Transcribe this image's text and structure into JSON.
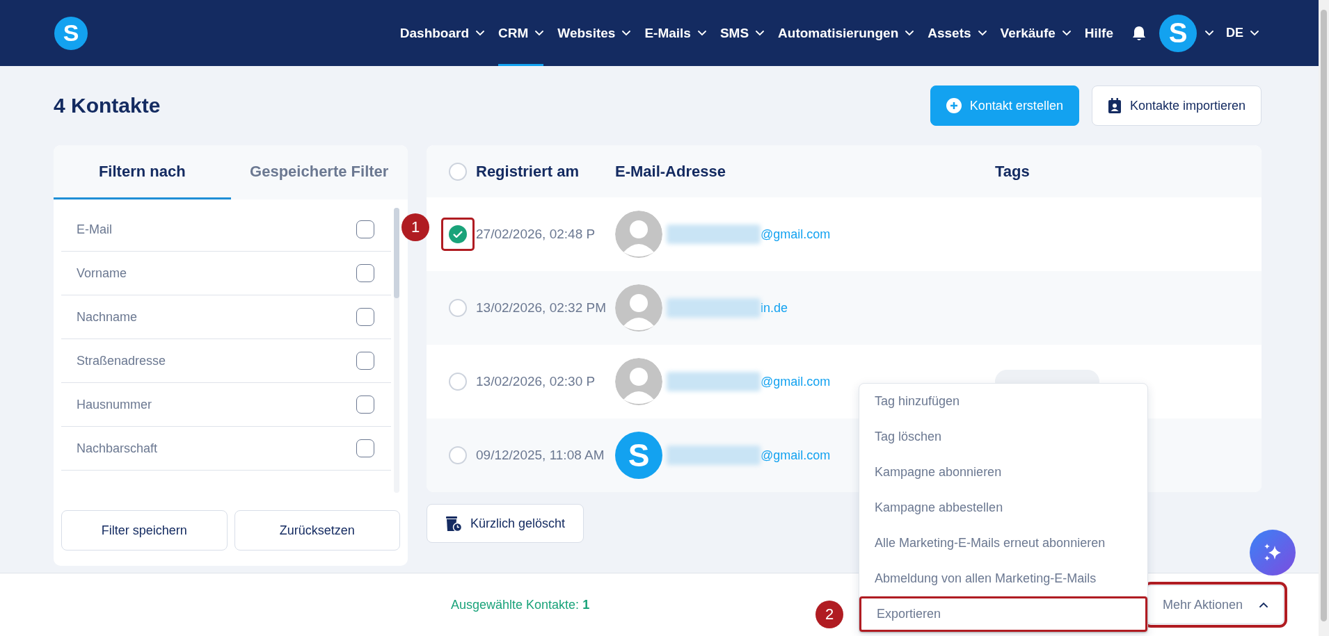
{
  "nav": {
    "logo": "S",
    "items": [
      {
        "label": "Dashboard",
        "selected": false,
        "dropdown": true
      },
      {
        "label": "CRM",
        "selected": true,
        "dropdown": true
      },
      {
        "label": "Websites",
        "selected": false,
        "dropdown": true
      },
      {
        "label": "E-Mails",
        "selected": false,
        "dropdown": true
      },
      {
        "label": "SMS",
        "selected": false,
        "dropdown": true
      },
      {
        "label": "Automatisierungen",
        "selected": false,
        "dropdown": true
      },
      {
        "label": "Assets",
        "selected": false,
        "dropdown": true
      },
      {
        "label": "Verkäufe",
        "selected": false,
        "dropdown": true
      },
      {
        "label": "Hilfe",
        "selected": false,
        "dropdown": false
      }
    ],
    "avatar": "S",
    "language": "DE"
  },
  "header": {
    "title": "4 Kontakte",
    "create_button": "Kontakt erstellen",
    "import_button": "Kontakte importieren"
  },
  "filter_panel": {
    "tabs": [
      {
        "label": "Filtern nach",
        "selected": true
      },
      {
        "label": "Gespeicherte Filter",
        "selected": false
      }
    ],
    "fields": [
      {
        "label": "E-Mail",
        "checked": false
      },
      {
        "label": "Vorname",
        "checked": false
      },
      {
        "label": "Nachname",
        "checked": false
      },
      {
        "label": "Straßenadresse",
        "checked": false
      },
      {
        "label": "Hausnummer",
        "checked": false
      },
      {
        "label": "Nachbarschaft",
        "checked": false
      }
    ],
    "buttons": [
      "Filter speichern",
      "Zurücksetzen"
    ]
  },
  "table": {
    "select_all": false,
    "columns": [
      "Registriert am",
      "E-Mail-Adresse",
      "Tags"
    ],
    "rows": [
      {
        "date": "27/02/2026, 02:48 P",
        "email": "@gmail.com",
        "selected": true,
        "highlighted": true,
        "annotation": "1",
        "kind": "placeholder",
        "tag_pill": false
      },
      {
        "date": "13/02/2026, 02:32 PM",
        "email": "in.de",
        "selected": false,
        "highlighted": false,
        "kind": "placeholder",
        "tag_pill": false
      },
      {
        "date": "13/02/2026, 02:30 P",
        "email": "@gmail.com",
        "selected": false,
        "highlighted": false,
        "kind": "placeholder",
        "tag_pill": true
      },
      {
        "date": "09/12/2025, 11:08 AM",
        "email": "@gmail.com",
        "selected": false,
        "highlighted": false,
        "kind": "letter",
        "avatar_letter": "S",
        "tag_pill": false
      }
    ]
  },
  "recently_deleted_button": "Kürzlich gelöscht",
  "footer": {
    "selected_text": "Ausgewählte Kontakte: **1**",
    "more_actions": {
      "label": "Mehr Aktionen",
      "expanded": true,
      "highlighted": true
    }
  },
  "actions_menu": [
    {
      "label": "Tag hinzufügen",
      "highlighted": false
    },
    {
      "label": "Tag löschen",
      "highlighted": false
    },
    {
      "label": "Kampagne abonnieren",
      "highlighted": false
    },
    {
      "label": "Kampagne abbestellen",
      "highlighted": false
    },
    {
      "label": "Alle Marketing-E-Mails erneut abonnieren",
      "highlighted": false
    },
    {
      "label": "Abmeldung von allen Marketing-E-Mails",
      "highlighted": false
    },
    {
      "label": "Exportieren",
      "highlighted": true,
      "annotation": "2"
    }
  ]
}
